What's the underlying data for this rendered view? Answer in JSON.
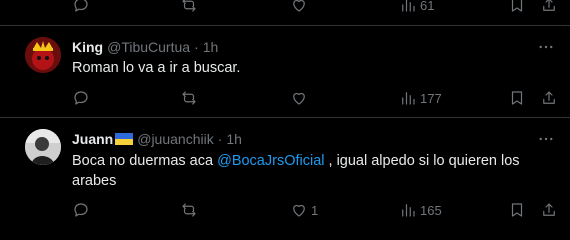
{
  "top_actions": {
    "views": "61"
  },
  "tweets": [
    {
      "name": "King",
      "handle": "@TibuCurtua",
      "time": "1h",
      "text": "Roman lo va a ir a buscar.",
      "likes": "",
      "views": "177"
    },
    {
      "name": "Juann",
      "handle": "@juuanchiik",
      "time": "1h",
      "text_before": "Boca no duermas aca ",
      "mention": "@BocaJrsOficial",
      "text_after": " , igual alpedo si lo quieren los arabes",
      "likes": "1",
      "views": "165"
    }
  ],
  "colors": {
    "background": "#000000",
    "text": "#e7e9ea",
    "muted": "#71767b",
    "link": "#1d9bf0",
    "divider": "#2f3336"
  },
  "icons": [
    "reply-icon",
    "retweet-icon",
    "like-icon",
    "views-icon",
    "bookmark-icon",
    "share-icon",
    "more-icon",
    "ukraine-flag-icon"
  ]
}
